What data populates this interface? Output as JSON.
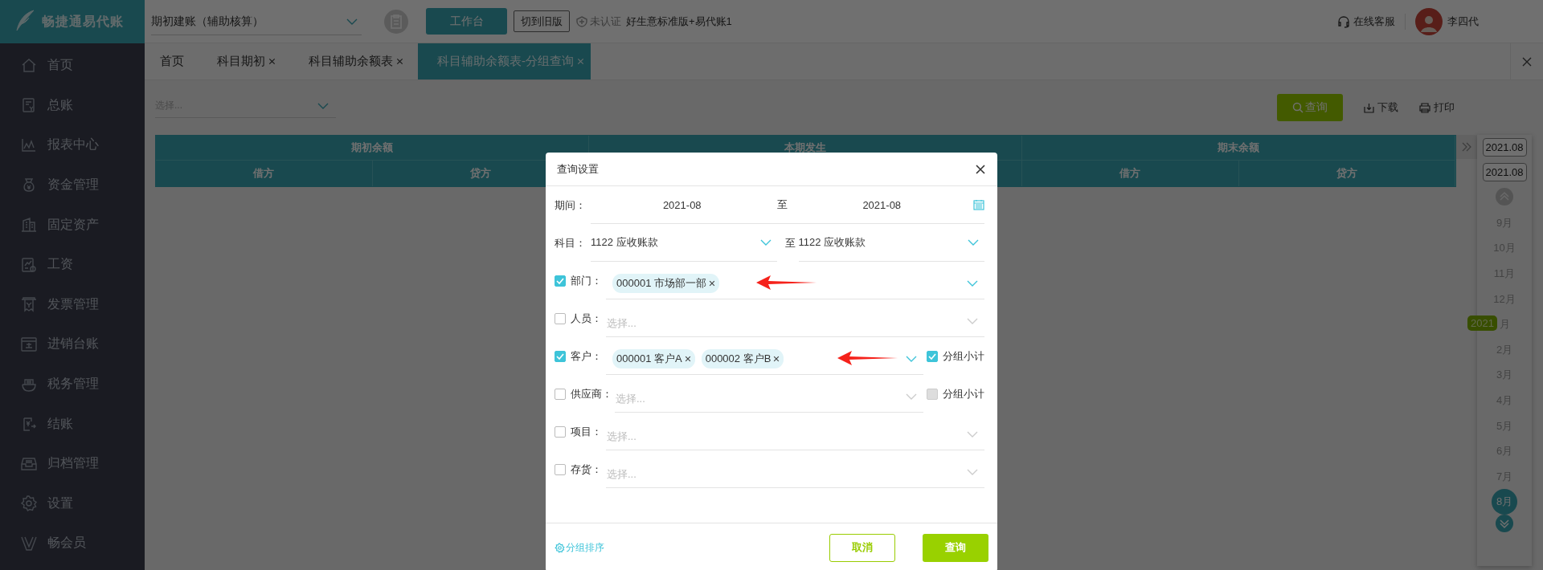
{
  "brand": {
    "name": "畅捷通易代账"
  },
  "sidebar": {
    "items": [
      {
        "label": "首页",
        "kind": "home",
        "selected": false
      },
      {
        "label": "总账",
        "kind": "ledger",
        "selected": false
      },
      {
        "label": "报表中心",
        "kind": "chart",
        "selected": false
      },
      {
        "label": "资金管理",
        "kind": "money",
        "selected": false
      },
      {
        "label": "固定资产",
        "kind": "building",
        "selected": false
      },
      {
        "label": "工资",
        "kind": "salary",
        "selected": false
      },
      {
        "label": "发票管理",
        "kind": "invoice",
        "selected": false
      },
      {
        "label": "进销台账",
        "kind": "stock",
        "selected": false
      },
      {
        "label": "税务管理",
        "kind": "tax",
        "selected": false
      },
      {
        "label": "结账",
        "kind": "closing",
        "selected": false
      },
      {
        "label": "归档管理",
        "kind": "archive",
        "selected": false
      },
      {
        "label": "设置",
        "kind": "settings",
        "selected": false
      },
      {
        "label": "畅会员",
        "kind": "member",
        "selected": false
      }
    ]
  },
  "header": {
    "account_select": {
      "value": "期初建账（辅助核算）"
    },
    "workbench_button": "工作台",
    "switch_button": "切到旧版",
    "cert_status": "未认证",
    "edition": "好生意标准版+易代账1",
    "support_link": "在线客服",
    "user_name": "李四代"
  },
  "tabs": [
    {
      "label": "首页",
      "closable": false,
      "selected": false
    },
    {
      "label": "科目期初",
      "closable": true,
      "selected": false
    },
    {
      "label": "科目辅助余额表",
      "closable": true,
      "selected": false
    },
    {
      "label": "科目辅助余额表-分组查询",
      "closable": true,
      "selected": true
    }
  ],
  "toolbar": {
    "filter": {
      "placeholder": "选择..."
    },
    "actions": [
      {
        "label": "查询",
        "kind": "primary"
      },
      {
        "label": "下载",
        "kind": "download"
      },
      {
        "label": "打印",
        "kind": "print"
      }
    ]
  },
  "table": {
    "groups": [
      {
        "label": "期初余额",
        "columns": [
          "借方",
          "贷方"
        ]
      },
      {
        "label": "本期发生"
      },
      {
        "label": "期末余额",
        "columns": [
          "借方",
          "贷方"
        ]
      }
    ]
  },
  "calendar": {
    "range_start": "2021.08",
    "range_end": "2021.08",
    "months": [
      {
        "label": "9月",
        "selected": false
      },
      {
        "label": "10月",
        "selected": false
      },
      {
        "label": "11月",
        "selected": false
      },
      {
        "label": "12月",
        "selected": false
      },
      {
        "label": "月",
        "selected": false,
        "year_badge": "2021"
      },
      {
        "label": "2月",
        "selected": false
      },
      {
        "label": "3月",
        "selected": false
      },
      {
        "label": "4月",
        "selected": false
      },
      {
        "label": "5月",
        "selected": false
      },
      {
        "label": "6月",
        "selected": false
      },
      {
        "label": "7月",
        "selected": false
      },
      {
        "label": "8月",
        "selected": true
      }
    ]
  },
  "dialog": {
    "title": "查询设置",
    "period": {
      "label": "期间：",
      "from": "2021-08",
      "separator": "至",
      "to": "2021-08"
    },
    "subject": {
      "label": "科目：",
      "from": "1122 应收账款",
      "separator": "至",
      "to": "1122 应收账款"
    },
    "filters": [
      {
        "label": "部门：",
        "checked": true,
        "tags": [
          "000001 市场部一部"
        ],
        "arrow": true
      },
      {
        "label": "人员：",
        "checked": false,
        "placeholder": "选择..."
      },
      {
        "label": "客户：",
        "checked": true,
        "tags": [
          "000001 客户A",
          "000002 客户B"
        ],
        "arrow": true,
        "subtotal": {
          "label": "分组小计",
          "checked": true
        }
      },
      {
        "label": "供应商：",
        "checked": false,
        "placeholder": "选择...",
        "subtotal": {
          "label": "分组小计",
          "checked": false
        }
      },
      {
        "label": "项目：",
        "checked": false,
        "placeholder": "选择..."
      },
      {
        "label": "存货：",
        "checked": false,
        "placeholder": "选择..."
      }
    ],
    "sort_link": "分组排序",
    "cancel_button": "取消",
    "query_button": "查询"
  }
}
